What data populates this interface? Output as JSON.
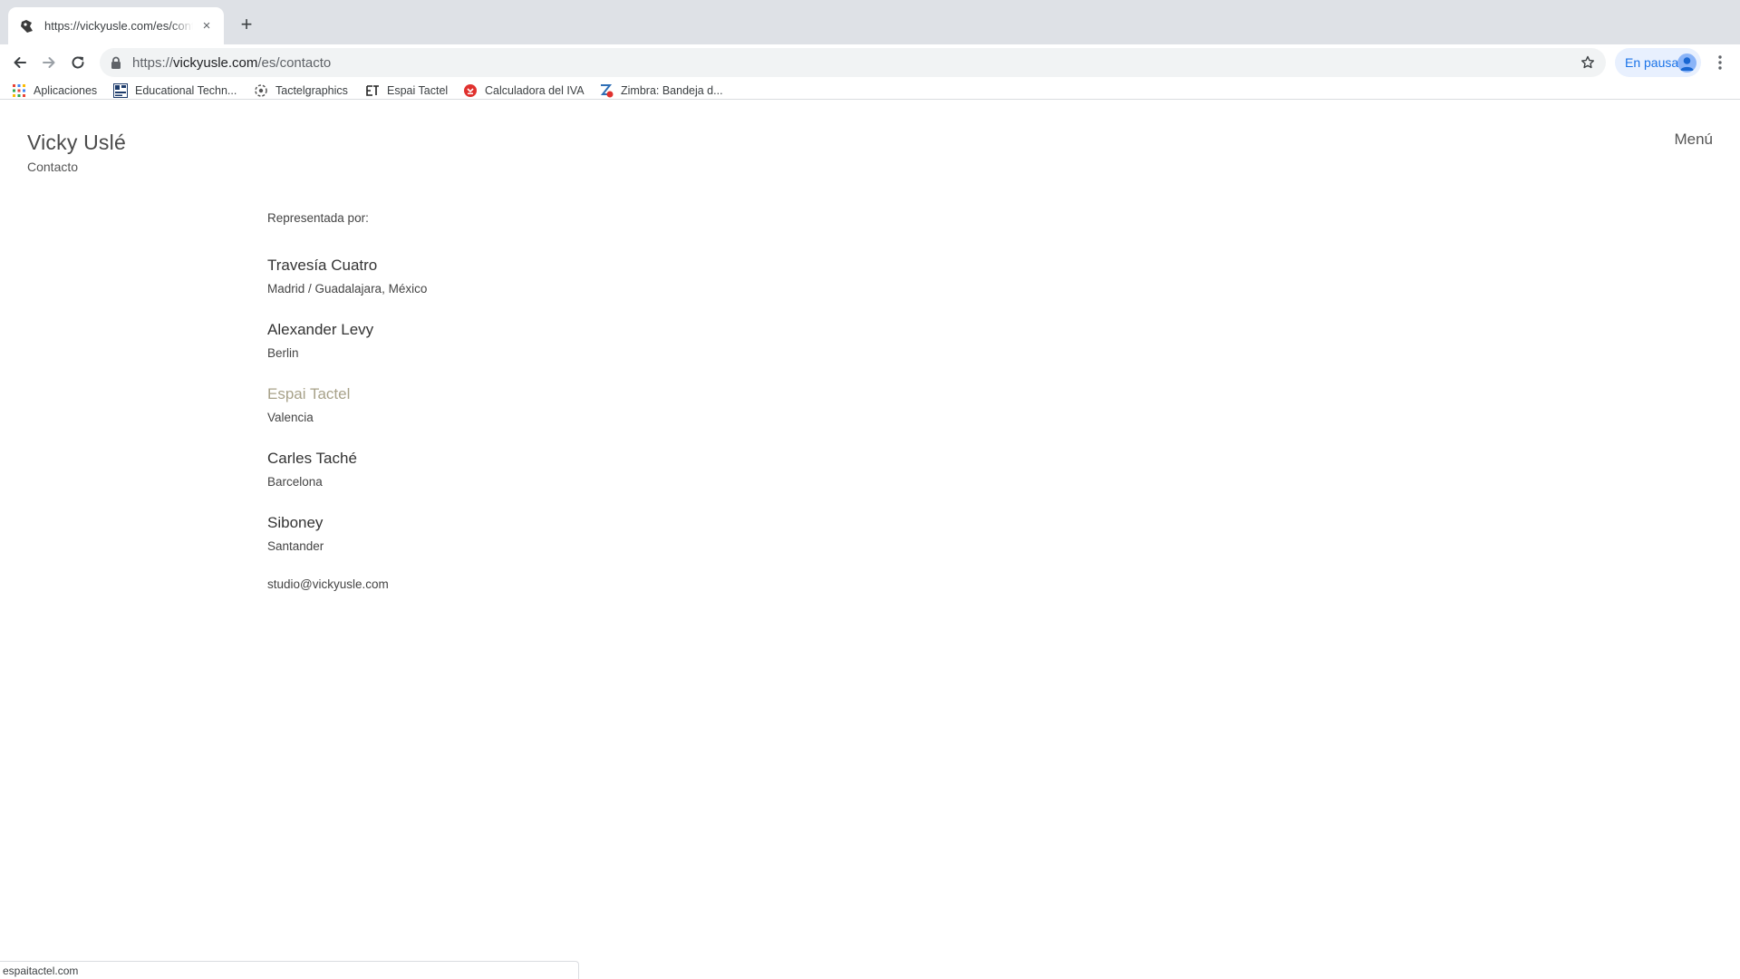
{
  "browser": {
    "tab": {
      "title": "https://vickyusle.com/es/contacto",
      "close_glyph": "×"
    },
    "new_tab_glyph": "+",
    "omnibox": {
      "scheme": "https://",
      "host": "vickyusle.com",
      "path": "/es/contacto"
    },
    "profile": {
      "label": "En pausa"
    },
    "bookmarks": [
      {
        "label": "Aplicaciones",
        "icon": "apps-grid-icon"
      },
      {
        "label": "Educational Techn...",
        "icon": "educational-tech-icon"
      },
      {
        "label": "Tactelgraphics",
        "icon": "tactelgraphics-icon"
      },
      {
        "label": "Espai Tactel",
        "icon": "espai-tactel-icon"
      },
      {
        "label": "Calculadora del IVA",
        "icon": "calculadora-iva-icon"
      },
      {
        "label": "Zimbra: Bandeja d...",
        "icon": "zimbra-icon"
      }
    ],
    "status_url": "espaitactel.com"
  },
  "site": {
    "title": "Vicky Uslé",
    "subtitle": "Contacto",
    "menu_label": "Menú"
  },
  "content": {
    "represented_by": "Representada por:",
    "galleries": [
      {
        "name": "Travesía Cuatro",
        "city": "Madrid / Guadalajara, México"
      },
      {
        "name": "Alexander Levy",
        "city": "Berlin"
      },
      {
        "name": "Espai Tactel",
        "city": "Valencia"
      },
      {
        "name": "Carles Taché",
        "city": "Barcelona"
      },
      {
        "name": "Siboney",
        "city": "Santander"
      }
    ],
    "email": "studio@vickyusle.com"
  },
  "colors": {
    "hover_link": "#a8a28a",
    "tabstrip": "#dee1e6",
    "profile_accent": "#1a73e8"
  }
}
